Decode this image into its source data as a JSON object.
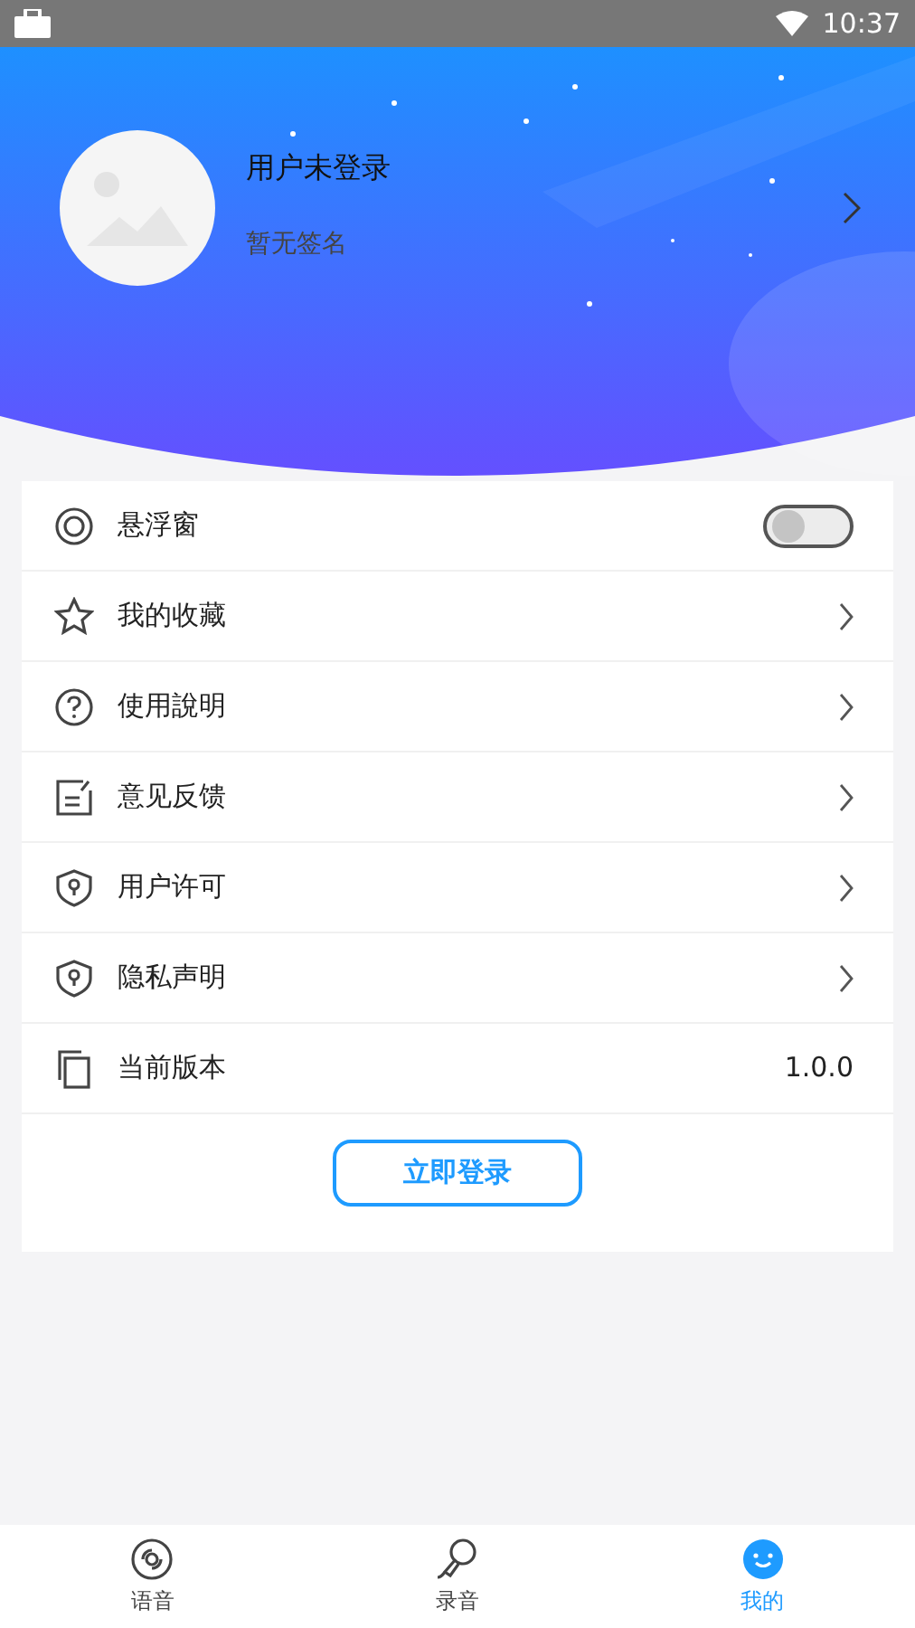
{
  "status_bar": {
    "time": "10:37"
  },
  "profile": {
    "name": "用户未登录",
    "signature": "暂无签名"
  },
  "menu": [
    {
      "kind": "toggle",
      "label": "悬浮窗",
      "on": false
    },
    {
      "kind": "link",
      "label": "我的收藏"
    },
    {
      "kind": "link",
      "label": "使用說明"
    },
    {
      "kind": "link",
      "label": "意见反馈"
    },
    {
      "kind": "link",
      "label": "用户许可"
    },
    {
      "kind": "link",
      "label": "隐私声明"
    },
    {
      "kind": "value",
      "label": "当前版本",
      "value": "1.0.0"
    }
  ],
  "login_button": "立即登录",
  "tabs": [
    {
      "label": "语音",
      "selected": false
    },
    {
      "label": "录音",
      "selected": false
    },
    {
      "label": "我的",
      "selected": true
    }
  ]
}
